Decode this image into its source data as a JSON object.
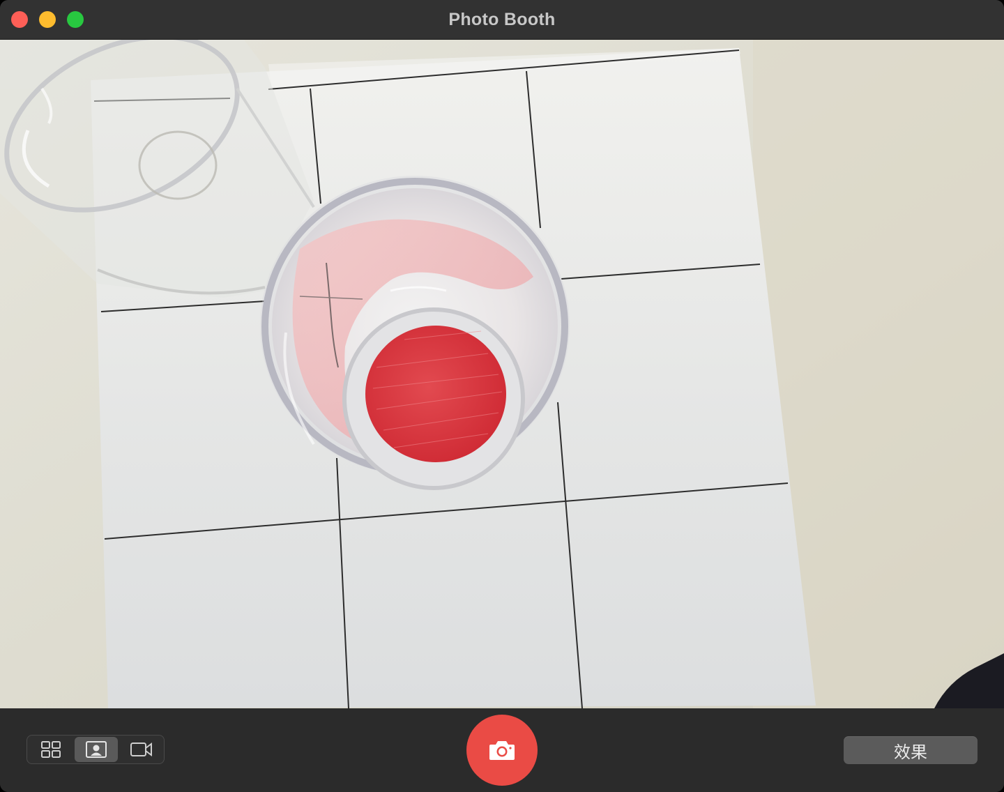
{
  "window": {
    "title": "Photo Booth"
  },
  "traffic_lights": {
    "close": "#fe5f57",
    "minimize": "#febc2e",
    "maximize": "#28c840"
  },
  "toolbar": {
    "modes": [
      {
        "icon": "grid-four-icon",
        "active": false
      },
      {
        "icon": "single-photo-icon",
        "active": true
      },
      {
        "icon": "video-camera-icon",
        "active": false
      }
    ],
    "shutter_icon": "camera-icon",
    "shutter_color": "#ea4b45",
    "effects_label": "效果"
  },
  "preview": {
    "scene": "camera-feed"
  }
}
